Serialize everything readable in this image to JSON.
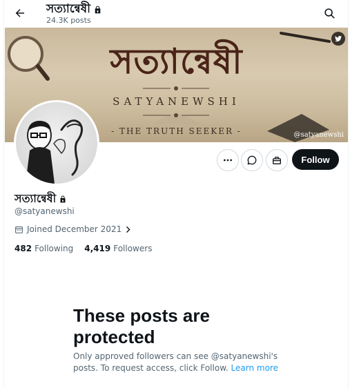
{
  "header": {
    "title": "সত্যান্বেষী",
    "post_count": "24.3K posts"
  },
  "banner": {
    "title_bengali": "সত্যান্বেষী",
    "subtitle": "SATYANEWSHI",
    "tagline": "- THE TRUTH SEEKER -",
    "watermark_handle": "@satyanewshi"
  },
  "actions": {
    "follow_label": "Follow"
  },
  "profile": {
    "display_name": "সত্যান্বেষী",
    "handle": "@satyanewshi",
    "joined": "Joined December 2021",
    "following_count": "482",
    "following_label": "Following",
    "followers_count": "4,419",
    "followers_label": "Followers"
  },
  "protected_notice": {
    "title": "These posts are protected",
    "description": "Only approved followers can see @satyanewshi's posts. To request access, click Follow.",
    "learn_more": "Learn more"
  },
  "colors": {
    "primary_text": "#0f1419",
    "secondary_text": "#536471",
    "link": "#1d9bf0",
    "follow_bg": "#0f1419"
  }
}
